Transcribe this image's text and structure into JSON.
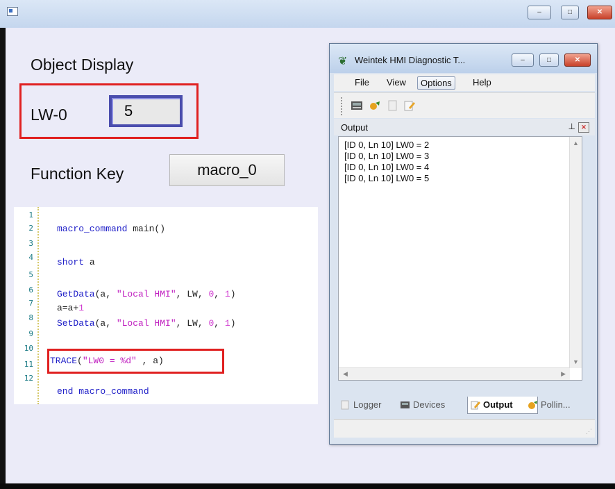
{
  "outer_window": {
    "caption_buttons": {
      "minimize": "‒",
      "maximize": "□",
      "close": "✕"
    }
  },
  "screen": {
    "object_display_label": "Object Display",
    "lw_label": "LW-0",
    "lw_value": "5",
    "function_key_label": "Function Key",
    "macro_button_label": "macro_0",
    "highlight_color": "#e02020"
  },
  "code": {
    "line_numbers": [
      "1",
      "2",
      "3",
      "4",
      "5",
      "6",
      "7",
      "8",
      "9",
      "10",
      "11",
      "12"
    ],
    "lines": {
      "l2_kw": "macro_command",
      "l2_rest": " main()",
      "l4_kw": "short",
      "l4_rest": " a",
      "l6_fn": "GetData",
      "l6_a": "(a, ",
      "l6_str": "\"Local HMI\"",
      "l6_b": ", LW, ",
      "l6_n0": "0",
      "l6_c": ", ",
      "l6_n1": "1",
      "l6_d": ")",
      "l7_a": "a=a+",
      "l7_n": "1",
      "l8_fn": "SetData",
      "l8_a": "(a, ",
      "l8_str": "\"Local HMI\"",
      "l8_b": ", LW, ",
      "l8_n0": "0",
      "l8_c": ", ",
      "l8_n1": "1",
      "l8_d": ")",
      "l10_fn": "TRACE",
      "l10_a": "(",
      "l10_str": "\"LW0 = %d\"",
      "l10_b": " , a)",
      "l12_kw": "end macro_command"
    }
  },
  "diag_window": {
    "title": "Weintek HMI Diagnostic T...",
    "menu": [
      "File",
      "View",
      "Options",
      "Help"
    ],
    "toolbar_icons": [
      "devices-icon",
      "polling-icon",
      "logger-icon",
      "output-icon"
    ],
    "output_panel_title": "Output",
    "output_lines": [
      "[ID 0, Ln 10] LW0 = 2",
      "[ID 0, Ln 10] LW0 = 3",
      "[ID 0, Ln 10] LW0 = 4",
      "[ID 0, Ln 10] LW0 = 5"
    ],
    "tabs": [
      "Logger",
      "Devices",
      "Output",
      "Pollin..."
    ],
    "active_tab": "Output"
  }
}
